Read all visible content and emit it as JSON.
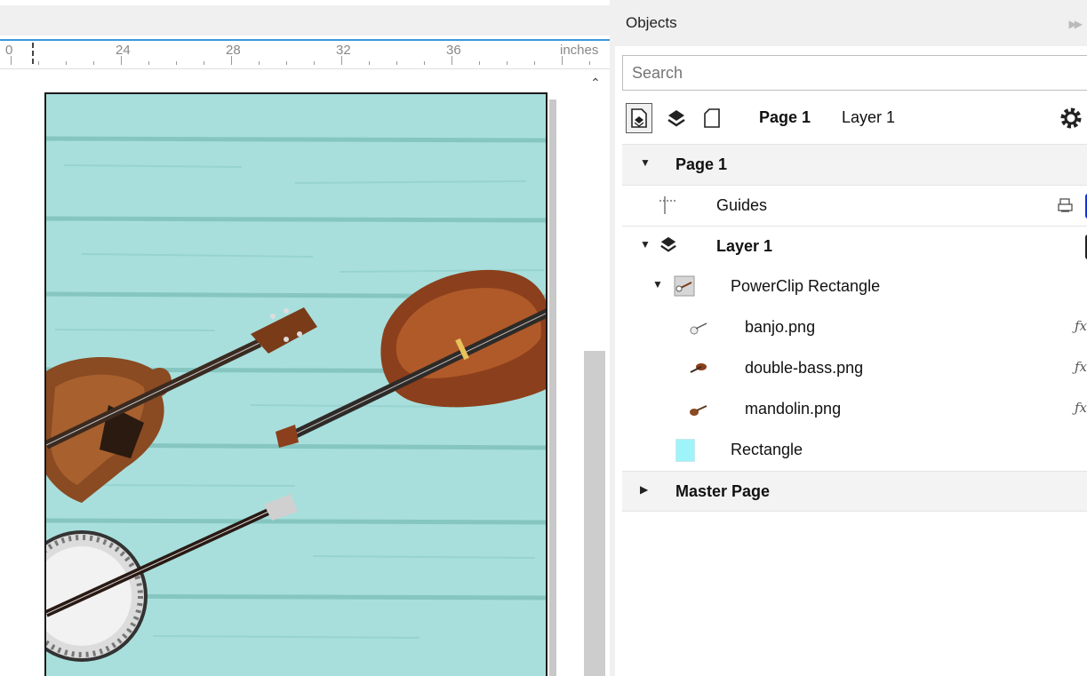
{
  "ruler": {
    "numbers": [
      "0",
      "24",
      "28",
      "32",
      "36"
    ],
    "unit": "inches"
  },
  "panel": {
    "title": "Objects",
    "search_placeholder": "Search",
    "toolbar": {
      "page_label": "Page 1",
      "layer_label": "Layer 1"
    },
    "tree": {
      "page1": {
        "label": "Page 1"
      },
      "guides": {
        "label": "Guides",
        "color": "#1433d6"
      },
      "layer1": {
        "label": "Layer 1",
        "color": "#222222"
      },
      "powerclip": {
        "label": "PowerClip Rectangle"
      },
      "banjo": {
        "label": "banjo.png"
      },
      "double_bass": {
        "label": "double-bass.png"
      },
      "mandolin": {
        "label": "mandolin.png"
      },
      "rectangle": {
        "label": "Rectangle",
        "fill": "#9ff4fa"
      },
      "master_page": {
        "label": "Master Page"
      }
    }
  },
  "colors": {
    "accent": "#3a9ad9",
    "canvas_background": "#a8dfdc",
    "wood_plank_line": "#8ccbc6"
  }
}
